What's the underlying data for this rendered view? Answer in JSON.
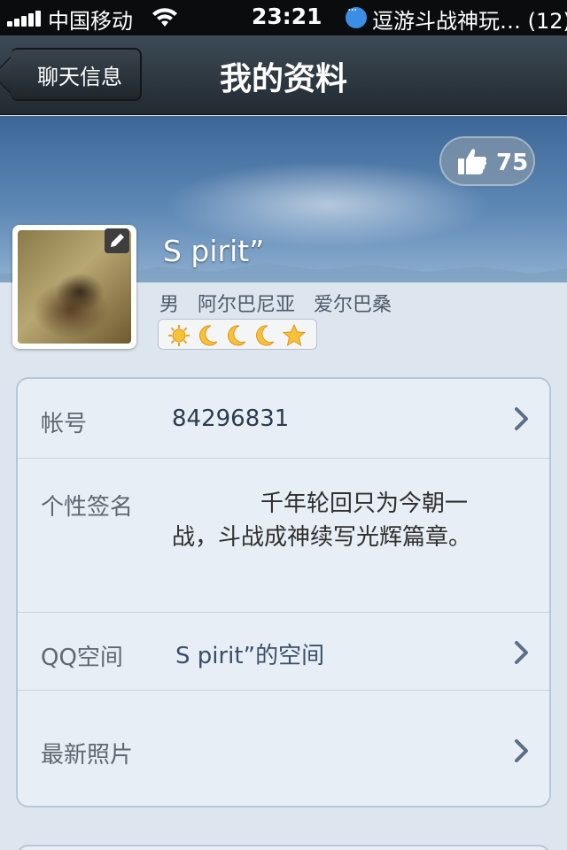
{
  "status_bar": {
    "carrier": "中国移动",
    "time": "23:21",
    "notification": "逗游斗战神玩… (12)"
  },
  "nav": {
    "back_label": "聊天信息",
    "title": "我的资料"
  },
  "profile": {
    "likes": "75",
    "name": "S pirit”",
    "gender": "男",
    "country": "阿尔巴尼亚",
    "city": "爱尔巴桑",
    "level_icons": [
      "sun-icon",
      "moon-icon",
      "moon-icon",
      "moon-icon",
      "star-icon"
    ]
  },
  "info": {
    "account_label": "帐号",
    "account_value": "84296831",
    "signature_label": "个性签名",
    "signature_value": "千年轮回只为今朝一战，斗战成神续写光辉篇章。",
    "qzone_label": "QQ空间",
    "qzone_value": "S pirit”的空间",
    "photos_label": "最新照片"
  },
  "colors": {
    "nav_bg": "#2c353d",
    "page_bg": "#dde6ef",
    "card_bg": "#e8eef5"
  }
}
